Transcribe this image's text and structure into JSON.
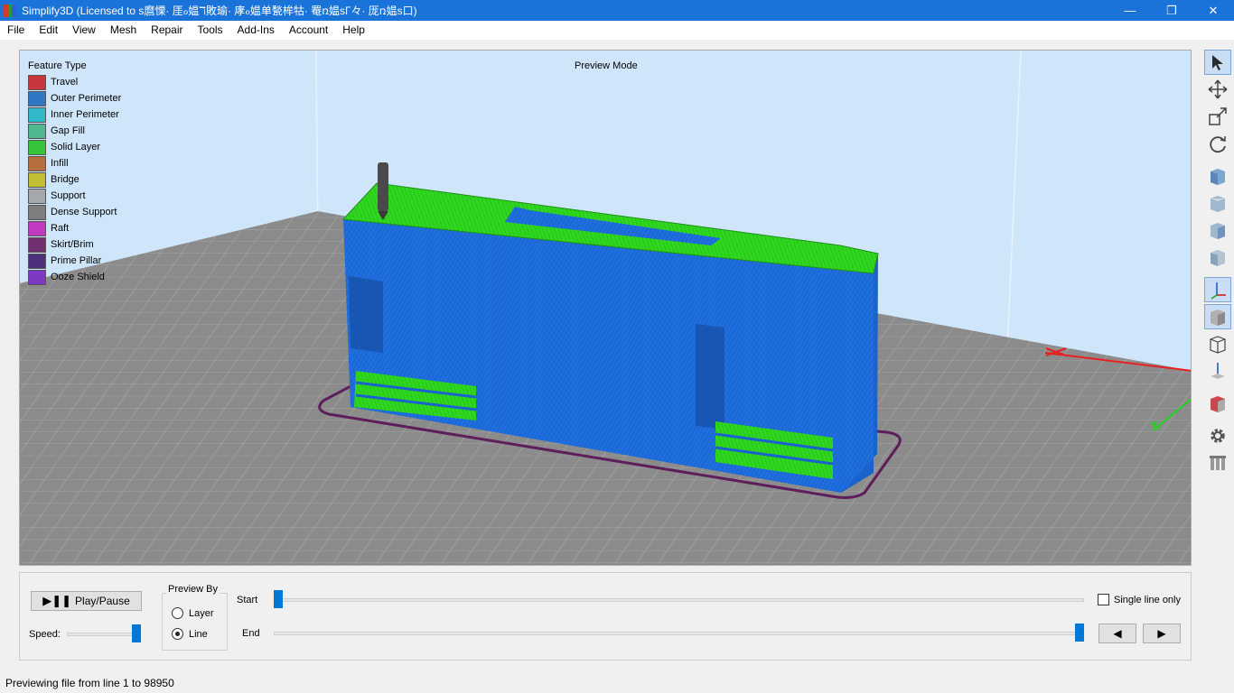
{
  "window": {
    "title": "Simplify3D (Licensed to s麿慄· 厓ℴ媪ℸ敗瑜· 庨ℴ媪单甃桙牯· 罨ռ媪sГ々· 厐ռ媪s口)",
    "minimize_glyph": "—",
    "maximize_glyph": "❐",
    "close_glyph": "✕"
  },
  "menu": [
    "File",
    "Edit",
    "View",
    "Mesh",
    "Repair",
    "Tools",
    "Add-Ins",
    "Account",
    "Help"
  ],
  "viewport": {
    "mode_label": "Preview Mode",
    "legend_title": "Feature Type",
    "legend": [
      {
        "label": "Travel",
        "color": "#c8373b"
      },
      {
        "label": "Outer Perimeter",
        "color": "#3077c4"
      },
      {
        "label": "Inner Perimeter",
        "color": "#31b9c9"
      },
      {
        "label": "Gap Fill",
        "color": "#4fb88e"
      },
      {
        "label": "Solid Layer",
        "color": "#36c43a"
      },
      {
        "label": "Infill",
        "color": "#b66f3c"
      },
      {
        "label": "Bridge",
        "color": "#c3bf34"
      },
      {
        "label": "Support",
        "color": "#a4a8ad"
      },
      {
        "label": "Dense Support",
        "color": "#7e7e80"
      },
      {
        "label": "Raft",
        "color": "#c23ac1"
      },
      {
        "label": "Skirt/Brim",
        "color": "#71306f"
      },
      {
        "label": "Prime Pillar",
        "color": "#4e2f7c"
      },
      {
        "label": "Ooze Shield",
        "color": "#7d38c4"
      }
    ]
  },
  "toolbar_icons": [
    "select-arrow-icon",
    "move-icon",
    "scale-icon",
    "rotate-icon",
    "view-iso-icon",
    "view-front-icon",
    "view-top-icon",
    "view-side-icon",
    "axes-icon",
    "solid-view-icon",
    "wireframe-view-icon",
    "normals-icon",
    "cross-section-icon",
    "settings-gear-icon",
    "supports-icon"
  ],
  "controls": {
    "play_label": "Play/Pause",
    "speed_label": "Speed:",
    "preview_by_label": "Preview By",
    "layer_label": "Layer",
    "line_label": "Line",
    "preview_by_selected": "Line",
    "start_label": "Start",
    "end_label": "End",
    "single_line_label": "Single line only",
    "single_line_checked": false,
    "prev_glyph": "◀",
    "next_glyph": "▶",
    "start_fraction": 0.0,
    "end_fraction": 1.0,
    "speed_fraction": 1.0
  },
  "status": "Previewing file from line 1 to 98950",
  "colors": {
    "accent": "#0078d7",
    "titlebar": "#1a73d9",
    "viewport_bg": "#cfe6fa",
    "bed": "#8a8a8a",
    "perimeter_blue": "#1a6fe0",
    "solid_green": "#2fd81e",
    "skirt": "#71306f"
  }
}
